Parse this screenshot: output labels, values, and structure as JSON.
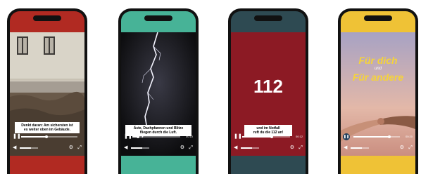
{
  "colors": {
    "phone1_band": "#b12a22",
    "phone2_band": "#47b397",
    "phone3_band": "#2e4a52",
    "phone3_video": "#8c1a24",
    "phone4_band": "#efc236",
    "hero_text": "#f5d33a"
  },
  "phones": [
    {
      "caption": "Denkt daran: Am sichersten ist\nes weiter oben im Gebäude.",
      "progress": 0.45,
      "time": ""
    },
    {
      "caption": "Äste, Dachpfannen und Blitze\nfliegen durch die Luft.",
      "progress": 0.12,
      "time": "00:10"
    },
    {
      "number": "112",
      "caption": "und im Notfall\nruft du die 112 an!",
      "progress": 0.62,
      "time": "00:12"
    },
    {
      "hero_line1": "Für dich",
      "hero_line2": "und",
      "hero_line3": "Für andere",
      "progress": 0.78,
      "time": "00:20"
    }
  ],
  "icons": {
    "play": "play-icon",
    "pause": "pause-icon",
    "volume": "volume-icon",
    "settings": "gear-icon",
    "fullscreen": "fullscreen-icon"
  }
}
